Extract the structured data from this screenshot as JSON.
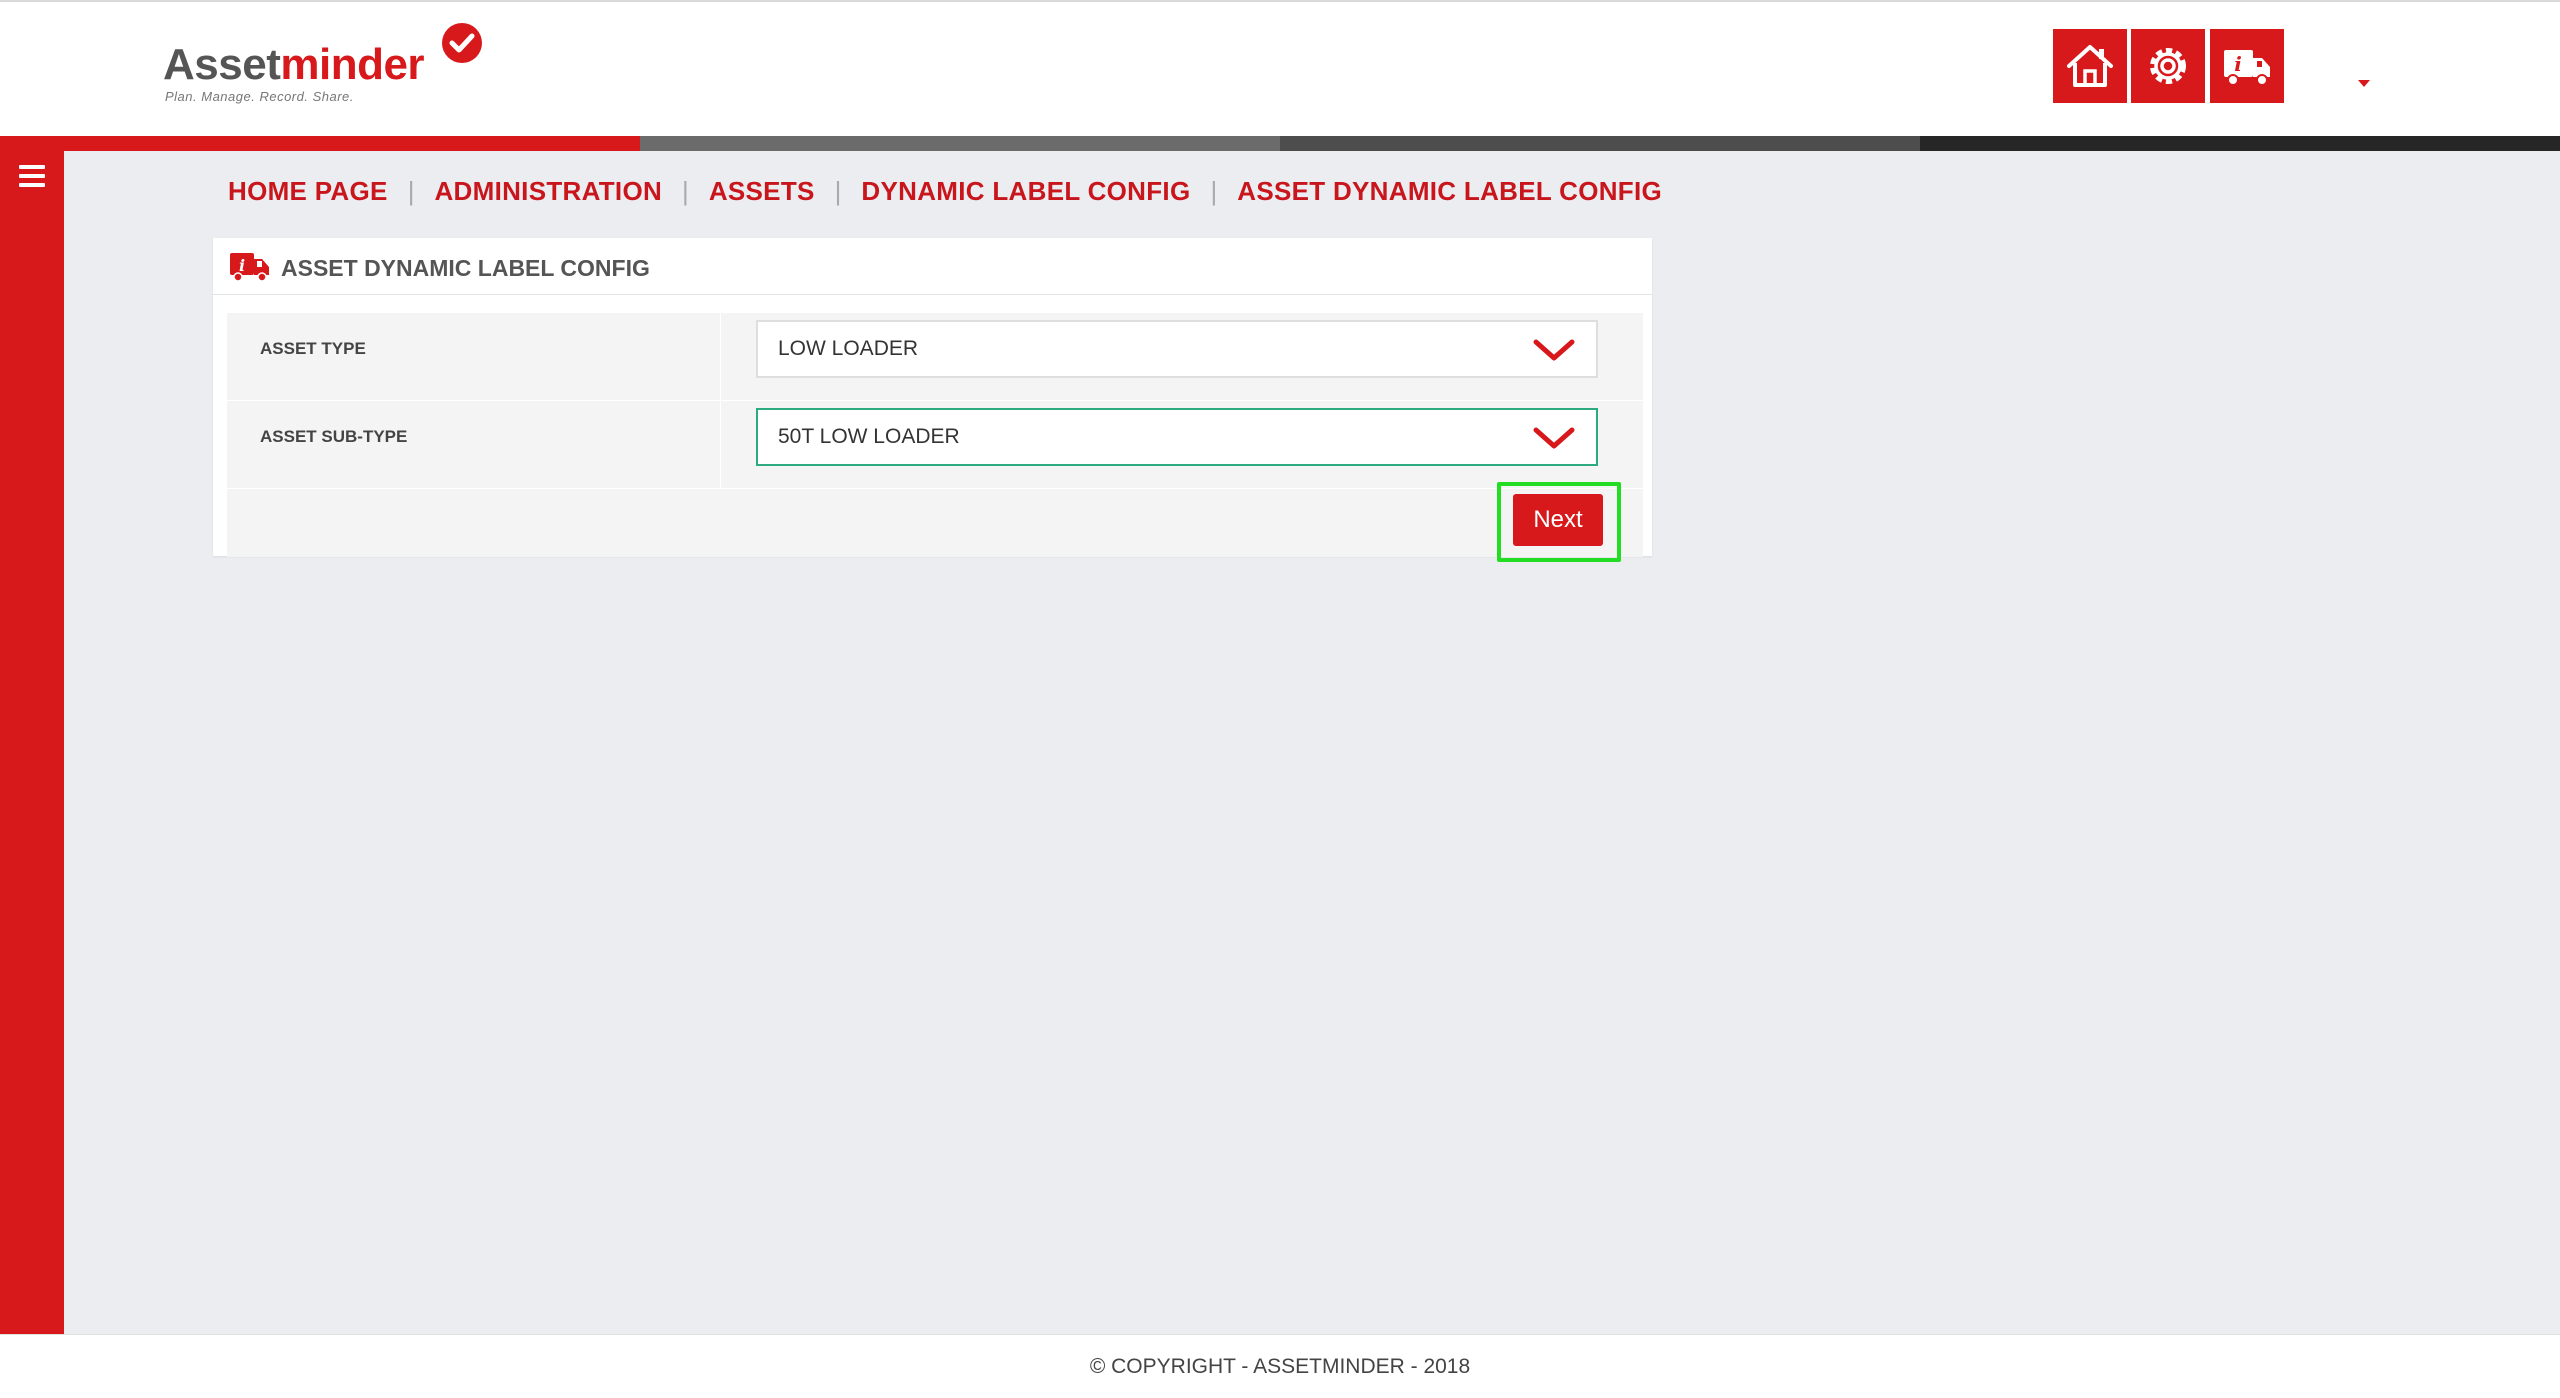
{
  "brand": {
    "name_part1": "Asset",
    "name_part2": "minder",
    "tagline": "Plan. Manage. Record. Share.",
    "primary_color": "#d7191c"
  },
  "header": {
    "icons": [
      "home-icon",
      "settings-icon",
      "asset-info-icon"
    ]
  },
  "band_colors": [
    "#d7191c",
    "#6b6b6b",
    "#4d4d4d",
    "#262626"
  ],
  "breadcrumb": [
    "HOME PAGE",
    "ADMINISTRATION",
    "ASSETS",
    "DYNAMIC LABEL CONFIG",
    "ASSET DYNAMIC LABEL CONFIG"
  ],
  "breadcrumb_separator": "|",
  "panel": {
    "title": "ASSET DYNAMIC LABEL CONFIG",
    "fields": [
      {
        "label": "ASSET TYPE",
        "value": "LOW LOADER"
      },
      {
        "label": "ASSET SUB-TYPE",
        "value": "50T LOW LOADER"
      }
    ],
    "next_label": "Next"
  },
  "footer": {
    "copyright": "© COPYRIGHT - ASSETMINDER - 2018"
  }
}
